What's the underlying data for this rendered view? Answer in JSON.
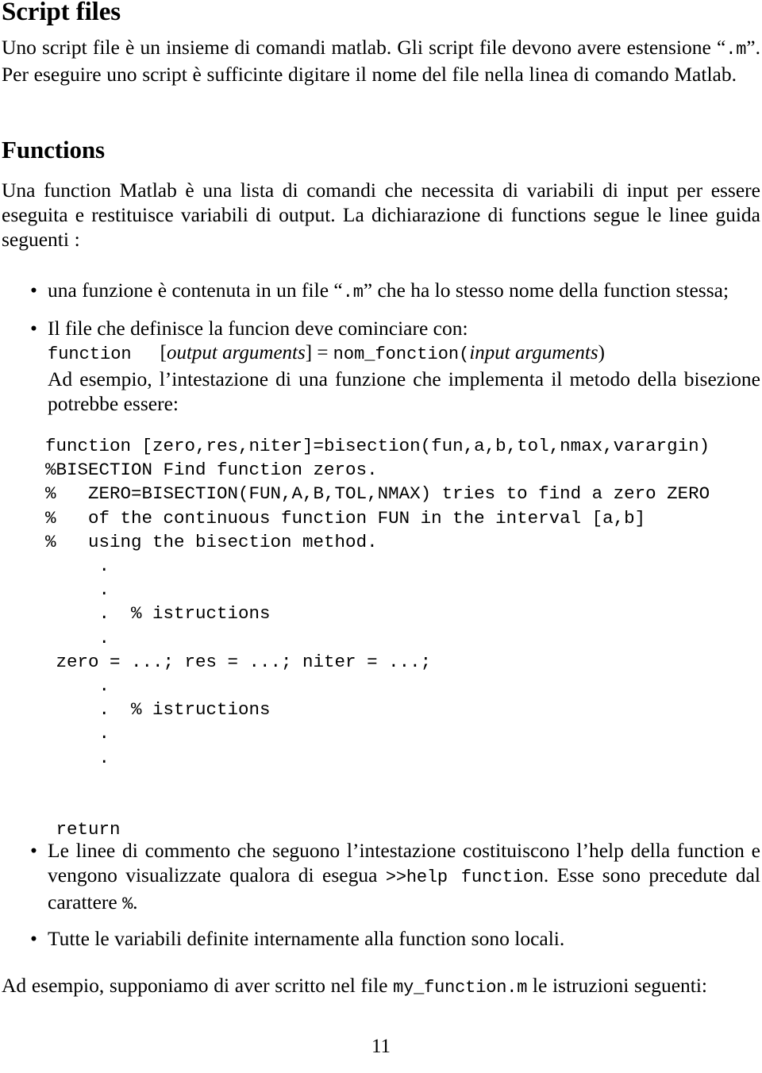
{
  "document": {
    "page_number": "11"
  },
  "sections": {
    "script_files": {
      "heading": "Script files",
      "paragraph_part1": "Uno script file è un insieme di comandi matlab.  Gli script file devono avere estensione “",
      "paragraph_mono1": ".m",
      "paragraph_part2": "”.  Per eseguire uno script è sufficinte digitare il nome del file nella linea di comando Matlab."
    },
    "functions": {
      "heading": "Functions",
      "intro": "Una function Matlab è una lista di comandi che necessita di variabili di input per essere eseguita e restituisce variabili di output.  La dichiarazione di functions segue le linee guida seguenti :",
      "bullets": [
        {
          "bullet_glyph": "•",
          "text_part1": "una funzione è contenuta in un file “",
          "mono1": ".m",
          "text_part2": "” che ha lo stesso nome della function stessa;"
        },
        {
          "bullet_glyph": "•",
          "intro_line": "Il file che definisce la funcion deve cominciare con:",
          "declaration": {
            "keyword": "function",
            "open_bracket": "[",
            "output_args": "output arguments",
            "close_bracket": "]",
            "equals": "=",
            "function_name": "nom_fonction(",
            "input_args": "input arguments",
            "close_paren": ")"
          },
          "example_line": "Ad esempio, l’intestazione di una funzione che implementa il metodo della bisezione potrebbe essere:"
        }
      ],
      "code_example": "function [zero,res,niter]=bisection(fun,a,b,tol,nmax,varargin)\n%BISECTION Find function zeros.\n%   ZERO=BISECTION(FUN,A,B,TOL,NMAX) tries to find a zero ZERO\n%   of the continuous function FUN in the interval [a,b]\n%   using the bisection method.\n     .\n     .\n     .  % istructions\n     .\n zero = ...; res = ...; niter = ...;\n     .\n     .  % istructions\n     .\n     .\n\n\n return",
      "bullets_after": [
        {
          "bullet_glyph": "•",
          "text_part1": "Le linee di commento che seguono l’intestazione costituiscono l’help della function e vengono visualizzate qualora di esegua ",
          "mono1": ">>help function",
          "text_part2": ".  Esse sono precedute dal carattere ",
          "mono2": "%",
          "text_part3": "."
        },
        {
          "bullet_glyph": "•",
          "text_part1": "Tutte le variabili definite internamente alla function sono locali."
        }
      ],
      "closing_part1": "Ad esempio, supponiamo di aver scritto nel file ",
      "closing_mono": "my_function.m",
      "closing_part2": " le istruzioni seguenti:"
    }
  }
}
